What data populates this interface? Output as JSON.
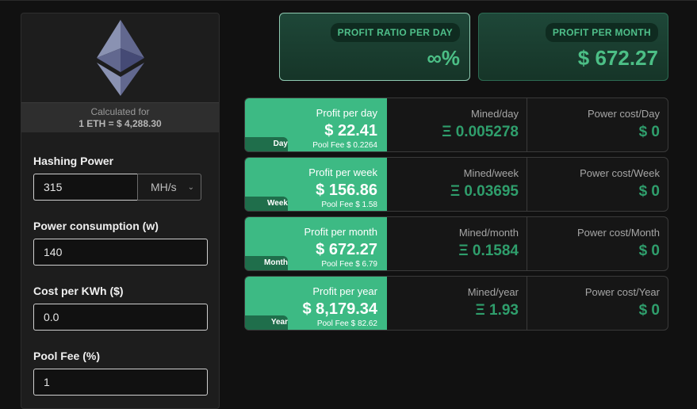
{
  "calc": {
    "caption": "Calculated for",
    "rate": "1 ETH = $ 4,288.30"
  },
  "form": {
    "hashing_label": "Hashing Power",
    "hashing_value": "315",
    "hashing_unit": "MH/s",
    "power_label": "Power consumption (w)",
    "power_value": "140",
    "cost_label": "Cost per KWh ($)",
    "cost_value": "0.0",
    "fee_label": "Pool Fee (%)",
    "fee_value": "1"
  },
  "summary": {
    "ratio_label": "PROFIT RATIO PER DAY",
    "ratio_value": "∞%",
    "month_label": "PROFIT PER MONTH",
    "month_value": "$ 672.27"
  },
  "rows": [
    {
      "tag": "Day",
      "profit_label": "Profit per day",
      "profit_value": "$ 22.41",
      "pool_fee": "Pool Fee $ 0.2264",
      "mined_label": "Mined/day",
      "mined_value": "Ξ 0.005278",
      "power_label": "Power cost/Day",
      "power_value": "$ 0"
    },
    {
      "tag": "Week",
      "profit_label": "Profit per week",
      "profit_value": "$ 156.86",
      "pool_fee": "Pool Fee $ 1.58",
      "mined_label": "Mined/week",
      "mined_value": "Ξ 0.03695",
      "power_label": "Power cost/Week",
      "power_value": "$ 0"
    },
    {
      "tag": "Month",
      "profit_label": "Profit per month",
      "profit_value": "$ 672.27",
      "pool_fee": "Pool Fee $ 6.79",
      "mined_label": "Mined/month",
      "mined_value": "Ξ 0.1584",
      "power_label": "Power cost/Month",
      "power_value": "$ 0"
    },
    {
      "tag": "Year",
      "profit_label": "Profit per year",
      "profit_value": "$ 8,179.34",
      "pool_fee": "Pool Fee $ 82.62",
      "mined_label": "Mined/year",
      "mined_value": "Ξ 1.93",
      "power_label": "Power cost/Year",
      "power_value": "$ 0"
    }
  ],
  "colors": {
    "accent": "#3dba84",
    "accent_dark": "#1f6e4b",
    "value_green": "#2f9e6c"
  },
  "icons": {
    "logo": "ethereum-icon",
    "select_arrow": "chevron-down-icon"
  }
}
